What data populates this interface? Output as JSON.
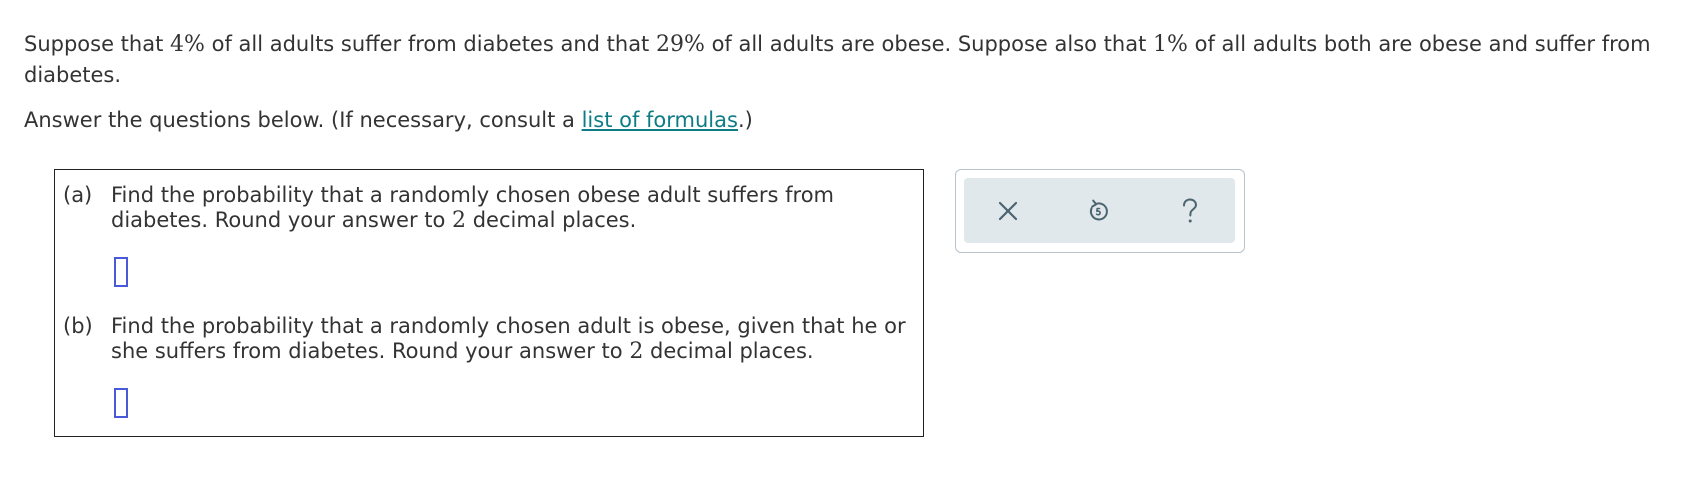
{
  "problem": {
    "s1_a": "Suppose that ",
    "diabetes_pct": "4%",
    "s1_b": " of all adults suffer from diabetes and that ",
    "obese_pct": "29%",
    "s1_c": " of all adults are obese. Suppose also that ",
    "both_pct": "1%",
    "s1_d": " of all adults both are obese and suffer from diabetes.",
    "s2_a": "Answer the questions below. (If necessary, consult a ",
    "formulas_link": "list of formulas",
    "s2_b": ".)"
  },
  "questions": [
    {
      "letter": "(a)",
      "text_a": "Find the probability that a randomly chosen obese adult suffers from diabetes. Round your answer to ",
      "places": "2",
      "text_b": " decimal places.",
      "answer_value": ""
    },
    {
      "letter": "(b)",
      "text_a": "Find the probability that a randomly chosen adult is obese, given that he or she suffers from diabetes. Round your answer to ",
      "places": "2",
      "text_b": " decimal places.",
      "answer_value": ""
    }
  ],
  "toolbar": {
    "clear_icon": "x-icon",
    "undo_icon": "undo-icon",
    "help_icon": "question-mark-icon",
    "icon_color": "#4a6470"
  },
  "colors": {
    "link": "#0e7c86",
    "answer_box_border": "#4a59d9",
    "toolbar_background": "#e1e8ec"
  }
}
